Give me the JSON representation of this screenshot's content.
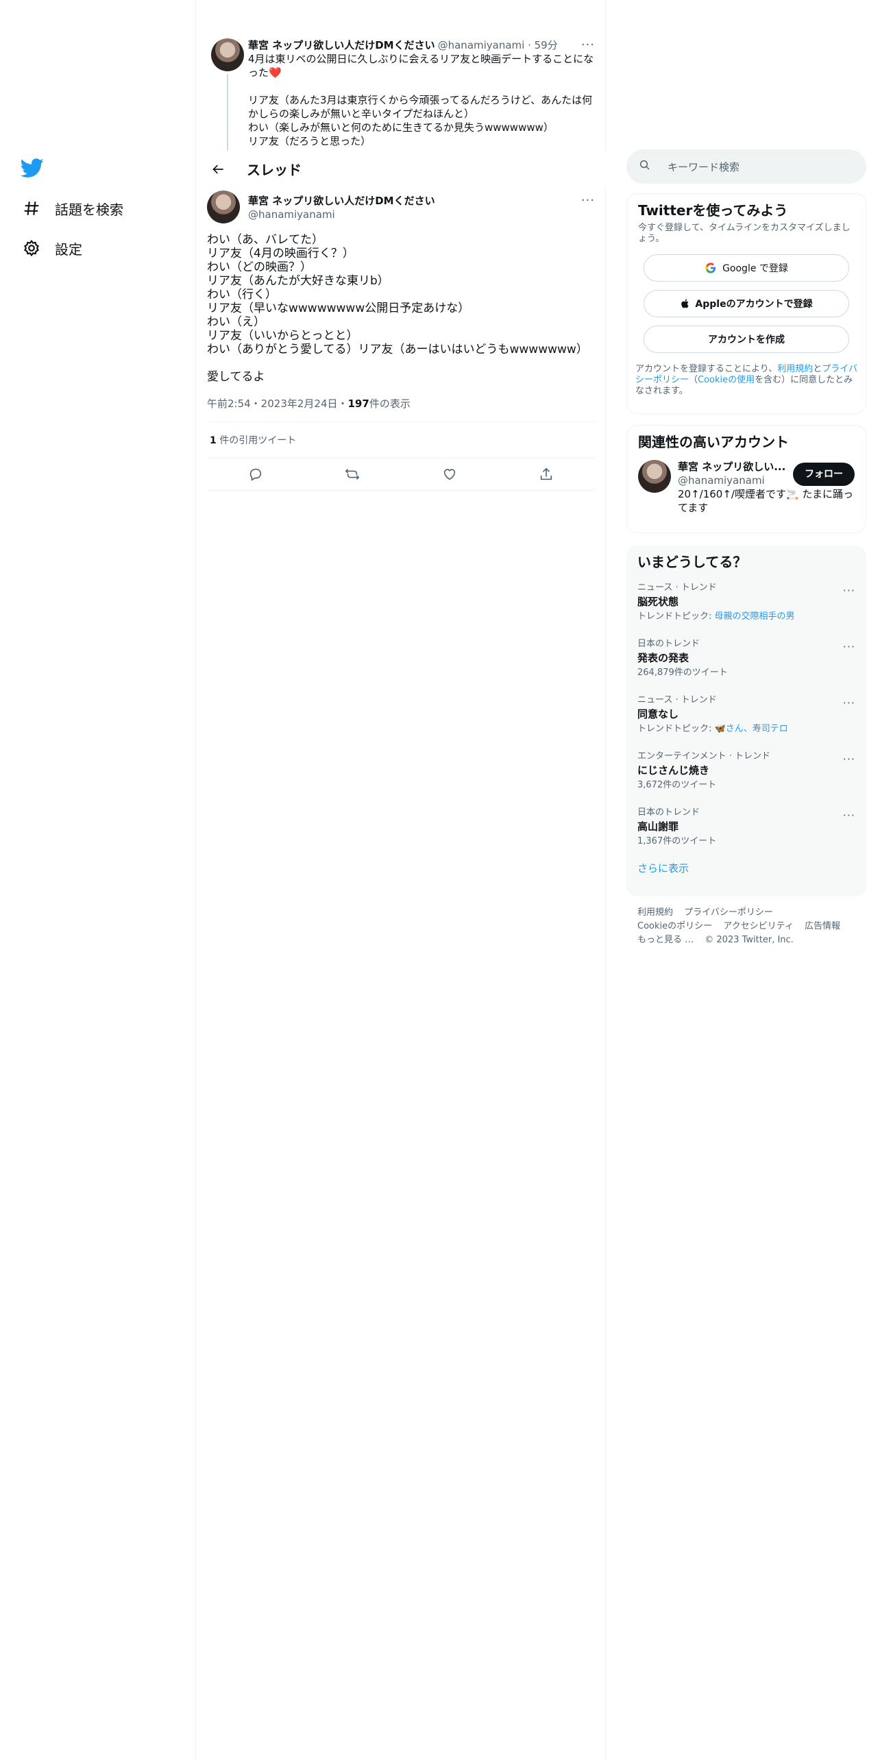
{
  "nav": {
    "items": [
      {
        "label": "話題を検索",
        "icon": "hashtag-icon"
      },
      {
        "label": "設定",
        "icon": "gear-icon"
      }
    ]
  },
  "prev_tweet": {
    "name": "華宮 ネップリ欲しい人だけDMください",
    "handle": "@hanamiyanami · 59分",
    "text": "4月は東リベの公開日に久しぶりに会えるリア友と映画デートすることになった❤️\n\nリア友（あんた3月は東京行くから今頑張ってるんだろうけど、あんたは何かしらの楽しみが無いと辛いタイプだねほんと）\nわい（楽しみが無いと何のために生きてるか見失うwwwwwww）\nリア友（だろうと思った）"
  },
  "header": {
    "title": "スレッド"
  },
  "tweet": {
    "name": "華宮 ネップリ欲しい人だけDMください",
    "handle": "@hanamiyanami",
    "text": "わい（あ、バレてた）\nリア友（4月の映画行く？）\nわい（どの映画？）\nリア友（あんたが大好きな東リb）\nわい（行く）\nリア友（早いなwwwwwwww公開日予定あけな）\nわい（え）\nリア友（いいからとっとと）\nわい（ありがとう愛してる）リア友（あーはいはいどうもwwwwwww）\n\n愛してるよ",
    "time": "午前2:54・2023年2月24日・",
    "views_count": "197",
    "views_label": " 件の表示",
    "quote_count": "1",
    "quote_label": " 件の引用ツイート"
  },
  "search": {
    "placeholder": "キーワード検索"
  },
  "signup": {
    "title": "Twitterを使ってみよう",
    "subtitle": "今すぐ登録して、タイムラインをカスタマイズしましょう。",
    "google_label": "Google で登録",
    "apple_label": "Appleのアカウントで登録",
    "create_label": "アカウントを作成",
    "legal_prefix": "アカウントを登録することにより、",
    "legal_terms": "利用規約",
    "legal_and": "と",
    "legal_privacy": "プライバシーポリシー",
    "legal_paren_open": "（",
    "legal_cookie": "Cookieの使用",
    "legal_suffix": "を含む）に同意したとみなされます。"
  },
  "related": {
    "title": "関連性の高いアカウント",
    "name": "華宮 ネップリ欲しい...",
    "handle": "@hanamiyanami",
    "follow_label": "フォロー",
    "bio": "20↑/160↑/喫煙者です🚬 たまに踊ってます"
  },
  "trends": {
    "title": "いまどうしてる？",
    "items": [
      {
        "category": "ニュース · トレンド",
        "name": "脳死状態",
        "extra_prefix": "トレンドトピック: ",
        "extra_link": "母親の交際相手の男"
      },
      {
        "category": "日本のトレンド",
        "name": "発表の発表",
        "extra_prefix": "264,879件のツイート",
        "extra_link": ""
      },
      {
        "category": "ニュース · トレンド",
        "name": "同意なし",
        "extra_prefix": "トレンドトピック: ",
        "extra_link": "🦋さん、寿司テロ"
      },
      {
        "category": "エンターテインメント · トレンド",
        "name": "にじさんじ焼き",
        "extra_prefix": "3,672件のツイート",
        "extra_link": ""
      },
      {
        "category": "日本のトレンド",
        "name": "高山謝罪",
        "extra_prefix": "1,367件のツイート",
        "extra_link": ""
      }
    ],
    "show_more": "さらに表示"
  },
  "footer": {
    "links": [
      "利用規約",
      "プライバシーポリシー",
      "Cookieのポリシー",
      "アクセシビリティ",
      "広告情報",
      "もっと見る …",
      "© 2023 Twitter, Inc."
    ]
  },
  "colors": {
    "accent": "#1d9bf0",
    "text": "#0f1419",
    "muted": "#536471"
  }
}
